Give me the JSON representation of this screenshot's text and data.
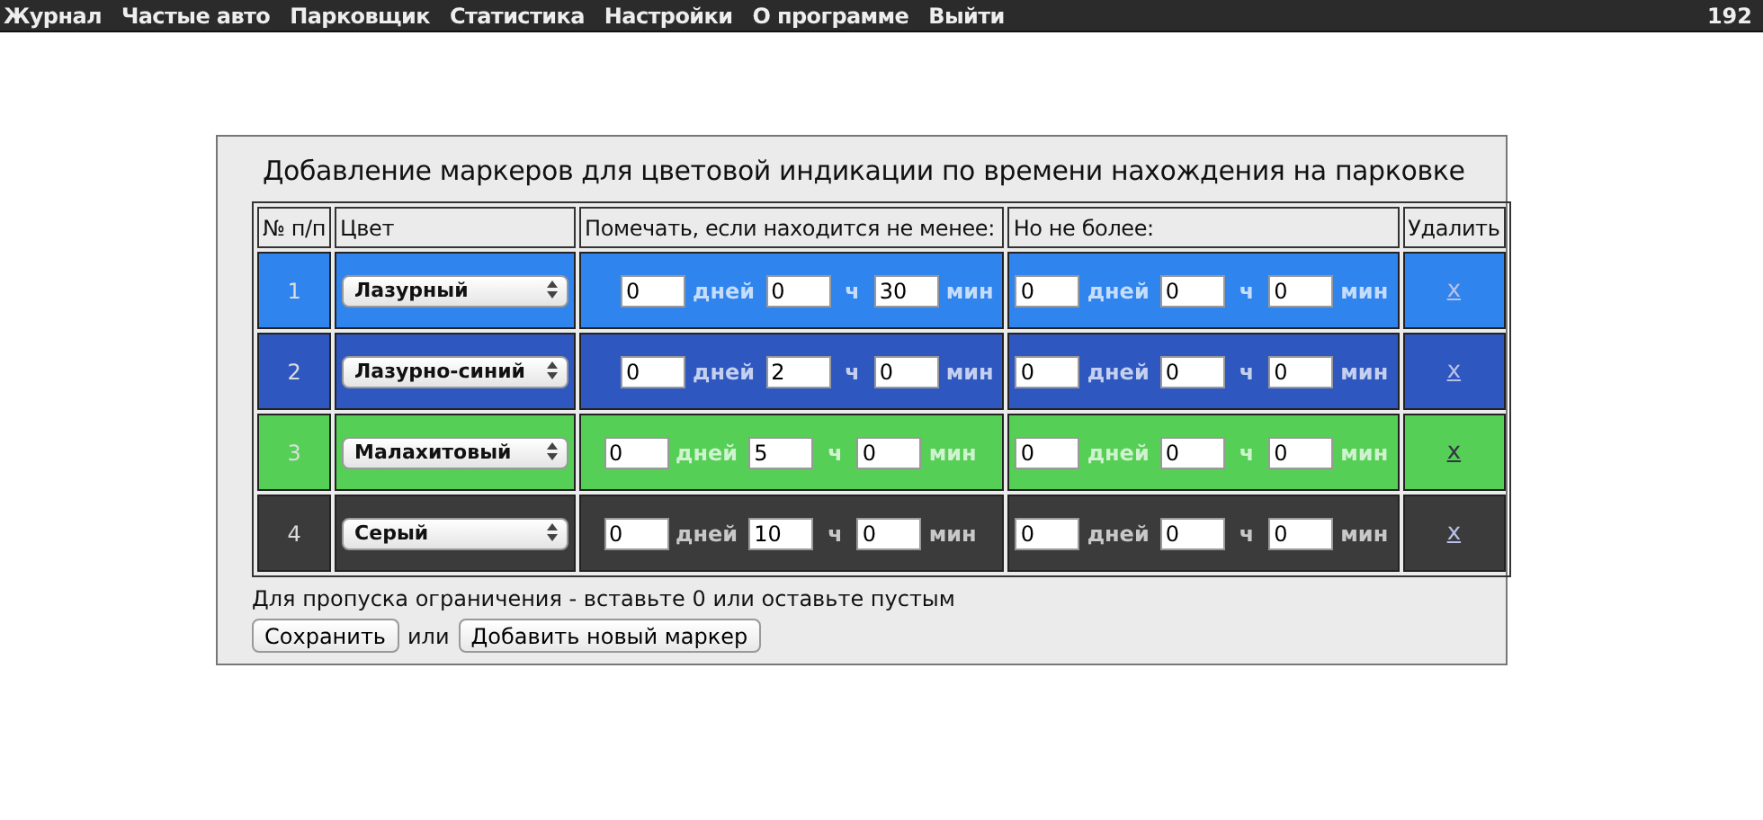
{
  "menu": {
    "items": [
      "Журнал",
      "Частые авто",
      "Парковщик",
      "Статистика",
      "Настройки",
      "О программе",
      "Выйти"
    ],
    "counter": "192"
  },
  "panel": {
    "title": "Добавление маркеров для цветовой индикации по времени нахождения на парковке",
    "columns": [
      "№ п/п",
      "Цвет",
      "Помечать, если находится не менее:",
      "Но не более:",
      "Удалить"
    ],
    "rows": [
      {
        "number": "1",
        "color": "#2f84ee",
        "color_name": "Лазурный",
        "min": [
          {
            "value": "0",
            "unit": "дней"
          },
          {
            "value": "0",
            "unit": "ч"
          },
          {
            "value": "30",
            "unit": "мин"
          }
        ],
        "max": [
          {
            "value": "0",
            "unit": "дней"
          },
          {
            "value": "0",
            "unit": "ч"
          },
          {
            "value": "0",
            "unit": "мин"
          }
        ],
        "delete": "x"
      },
      {
        "number": "2",
        "color": "#2e57c0",
        "color_name": "Лазурно-синий",
        "min": [
          {
            "value": "0",
            "unit": "дней"
          },
          {
            "value": "2",
            "unit": "ч"
          },
          {
            "value": "0",
            "unit": "мин"
          }
        ],
        "max": [
          {
            "value": "0",
            "unit": "дней"
          },
          {
            "value": "0",
            "unit": "ч"
          },
          {
            "value": "0",
            "unit": "мин"
          }
        ],
        "delete": "x"
      },
      {
        "number": "3",
        "color": "#55cf55",
        "color_name": "Малахитовый",
        "min": [
          {
            "value": "0",
            "unit": "дней"
          },
          {
            "value": "5",
            "unit": "ч"
          },
          {
            "value": "0",
            "unit": "мин"
          }
        ],
        "max": [
          {
            "value": "0",
            "unit": "дней"
          },
          {
            "value": "0",
            "unit": "ч"
          },
          {
            "value": "0",
            "unit": "мин"
          }
        ],
        "delete": "x"
      },
      {
        "number": "4",
        "color": "#3b3b3b",
        "color_name": "Серый",
        "min": [
          {
            "value": "0",
            "unit": "дней"
          },
          {
            "value": "10",
            "unit": "ч"
          },
          {
            "value": "0",
            "unit": "мин"
          }
        ],
        "max": [
          {
            "value": "0",
            "unit": "дней"
          },
          {
            "value": "0",
            "unit": "ч"
          },
          {
            "value": "0",
            "unit": "мин"
          }
        ],
        "delete": "x"
      }
    ],
    "hint": "Для пропуска ограничения - вставьте 0 или оставьте пустым",
    "save_button": "Сохранить",
    "separator": "или",
    "add_button": "Добавить новый маркер"
  }
}
